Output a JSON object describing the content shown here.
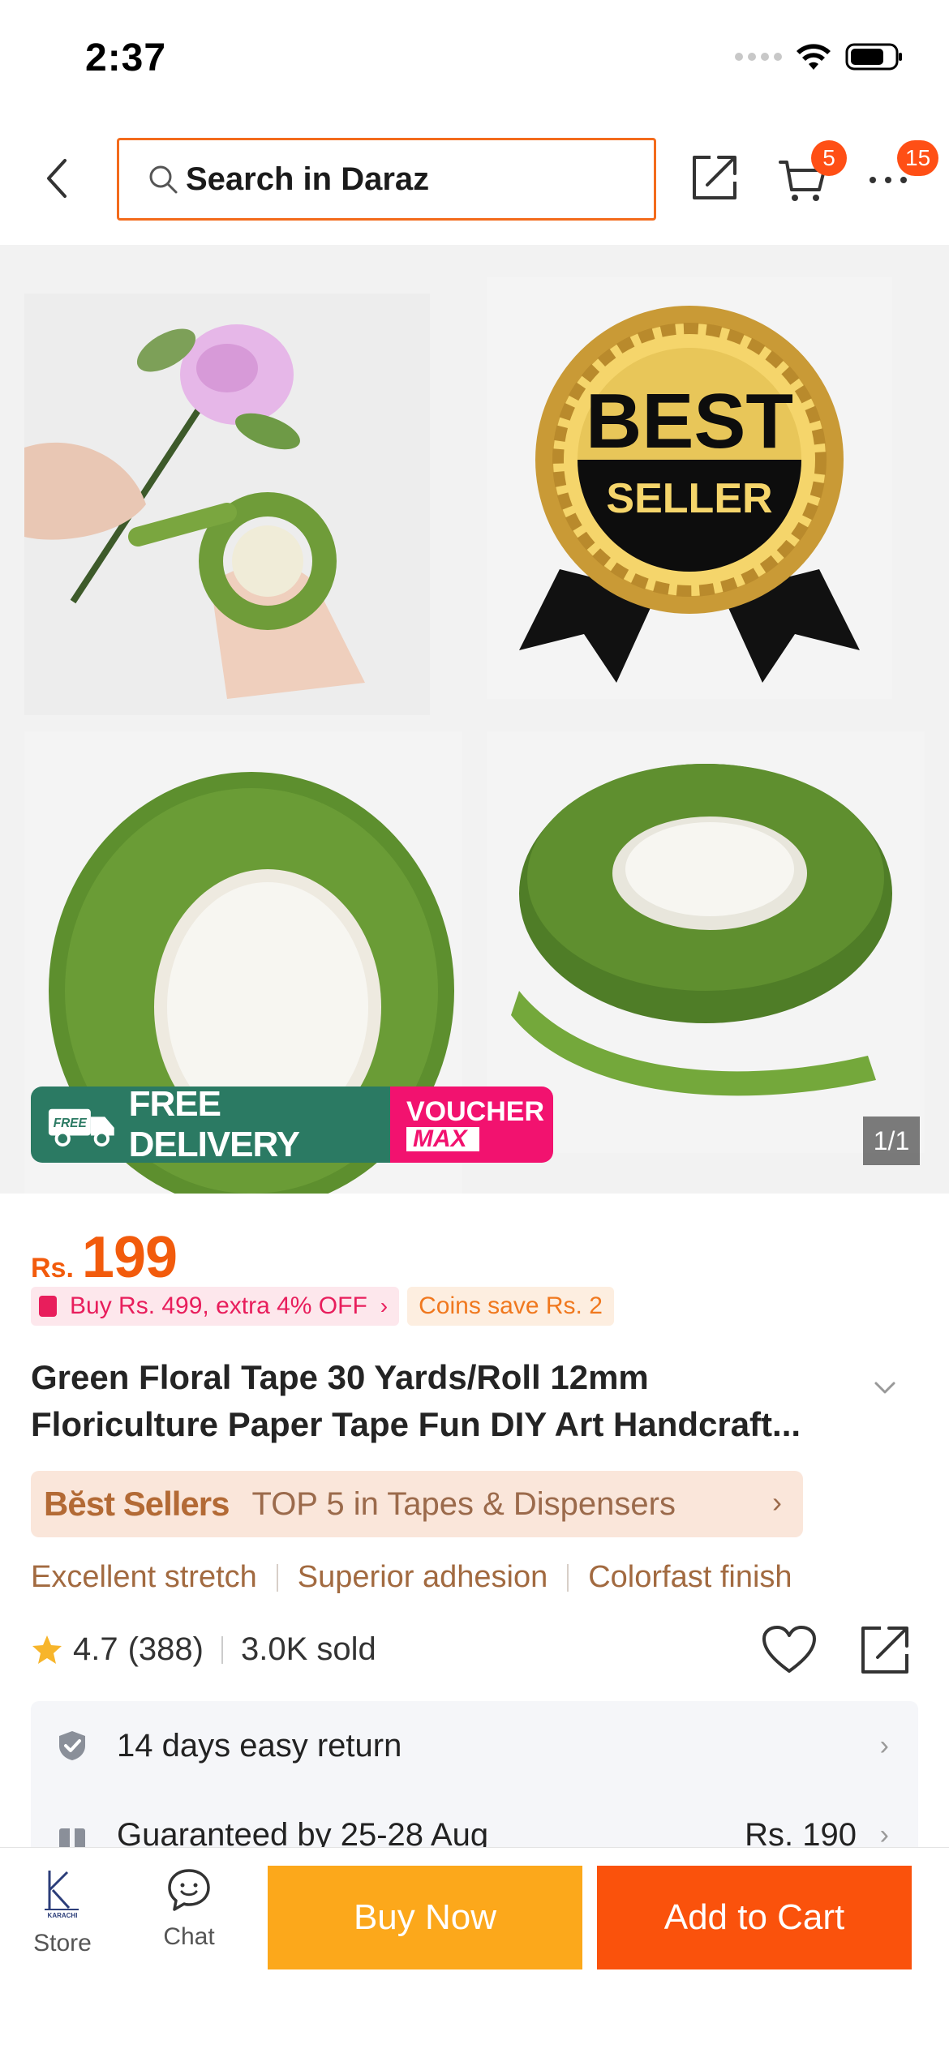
{
  "status_bar": {
    "time": "2:37"
  },
  "header": {
    "search_placeholder": "Search in Daraz",
    "cart_badge": "5",
    "more_badge": "15"
  },
  "gallery": {
    "counter": "1/1",
    "promo": {
      "free_small": "FREE",
      "free_delivery": "FREE DELIVERY",
      "voucher": "VOUCHER",
      "max": "MAX"
    },
    "badge_text": {
      "best": "BEST",
      "seller": "SELLER"
    }
  },
  "product": {
    "currency": "Rs.",
    "price": "199",
    "promo_tag": "Buy Rs. 499, extra 4% OFF",
    "coins_tag": "Coins save Rs. 2",
    "title_line1": "Green Floral Tape 30 Yards/Roll 12mm",
    "title_line2": "Floriculture Paper Tape Fun DIY Art Handcraft...",
    "bestsellers_badge": "Bĕst Sellers",
    "bestsellers_text": "TOP 5 in Tapes & Dispensers",
    "features": [
      "Excellent stretch",
      "Superior adhesion",
      "Colorfast finish"
    ],
    "rating": "4.7",
    "reviews": "(388)",
    "sold": "3.0K sold"
  },
  "info": {
    "return": "14 days easy return",
    "delivery": "Guaranteed by 25-28 Aug",
    "delivery_price": "Rs. 190"
  },
  "bottom_bar": {
    "store": "Store",
    "store_logo_text": "KARACHI",
    "chat": "Chat",
    "buy_now": "Buy Now",
    "add_to_cart": "Add to Cart"
  },
  "colors": {
    "accent_orange": "#f36b1c",
    "price_orange": "#f25b0c",
    "buy_now_yellow": "#fca81b",
    "add_to_cart_orange": "#fa520c",
    "promo_green": "#2b7a63",
    "voucher_pink": "#f2126f"
  }
}
